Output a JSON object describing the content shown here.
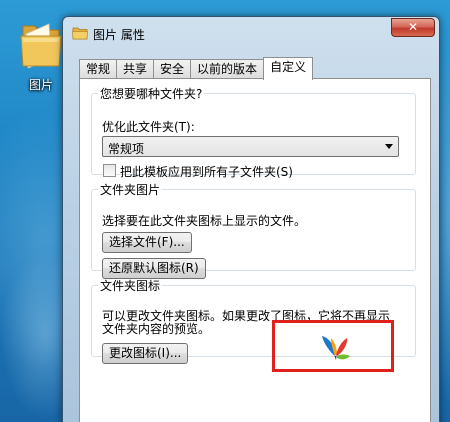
{
  "desktop": {
    "icon_label": "图片"
  },
  "window": {
    "title": "图片 属性",
    "close_label": "✕"
  },
  "tabs": [
    {
      "label": "常规",
      "active": false
    },
    {
      "label": "共享",
      "active": false
    },
    {
      "label": "安全",
      "active": false
    },
    {
      "label": "以前的版本",
      "active": false
    },
    {
      "label": "自定义",
      "active": true
    }
  ],
  "optimize_group": {
    "legend": "您想要哪种文件夹?",
    "optimize_label": "优化此文件夹(T):",
    "optimize_value": "常规项",
    "apply_subfolders_label": "把此模板应用到所有子文件夹(S)",
    "apply_subfolders_checked": false
  },
  "folder_picture_group": {
    "legend": "文件夹图片",
    "description": "选择要在此文件夹图标上显示的文件。",
    "choose_file_button": "选择文件(F)...",
    "restore_default_button": "还原默认图标(R)"
  },
  "folder_icon_group": {
    "legend": "文件夹图标",
    "description_line1": "可以更改文件夹图标。如果更改了图标，它将不再显示",
    "description_line2": "文件夹内容的预览。",
    "change_icon_button": "更改图标(I)..."
  },
  "colors": {
    "highlight": "#e0201a",
    "accent": "#1f86c6"
  }
}
